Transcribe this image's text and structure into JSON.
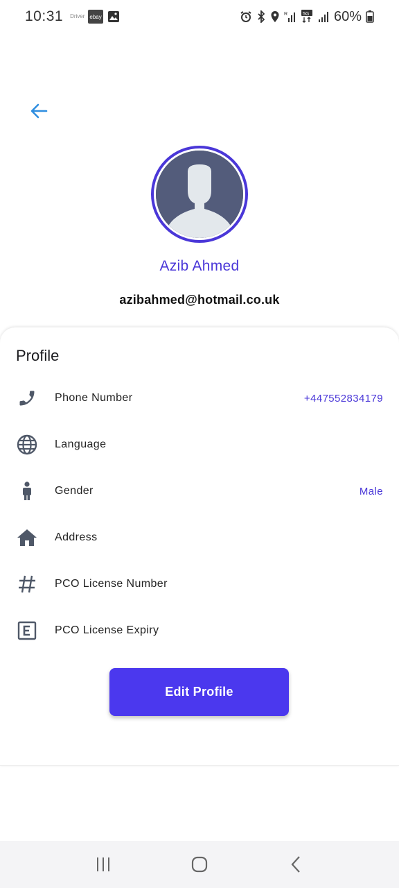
{
  "status_bar": {
    "time": "10:31",
    "notif_driver": "Driver",
    "notif_ebay": "ebay",
    "battery": "60%"
  },
  "colors": {
    "accent": "#4a37d8",
    "button": "#4b38ee",
    "back_arrow": "#2f8ee0",
    "icon": "#4f5868"
  },
  "profile": {
    "name": "Azib Ahmed",
    "email": "azibahmed@hotmail.co.uk",
    "section_title": "Profile",
    "rows": [
      {
        "icon": "phone-icon",
        "label": "Phone Number",
        "value": "+447552834179"
      },
      {
        "icon": "globe-icon",
        "label": "Language",
        "value": ""
      },
      {
        "icon": "person-icon",
        "label": "Gender",
        "value": "Male"
      },
      {
        "icon": "home-icon",
        "label": "Address",
        "value": ""
      },
      {
        "icon": "hash-icon",
        "label": "PCO License Number",
        "value": ""
      },
      {
        "icon": "letter-e-icon",
        "label": "PCO License Expiry",
        "value": ""
      }
    ],
    "edit_label": "Edit Profile"
  },
  "nav": {
    "recents": "recents-icon",
    "home": "home-nav-icon",
    "back": "back-nav-icon"
  }
}
